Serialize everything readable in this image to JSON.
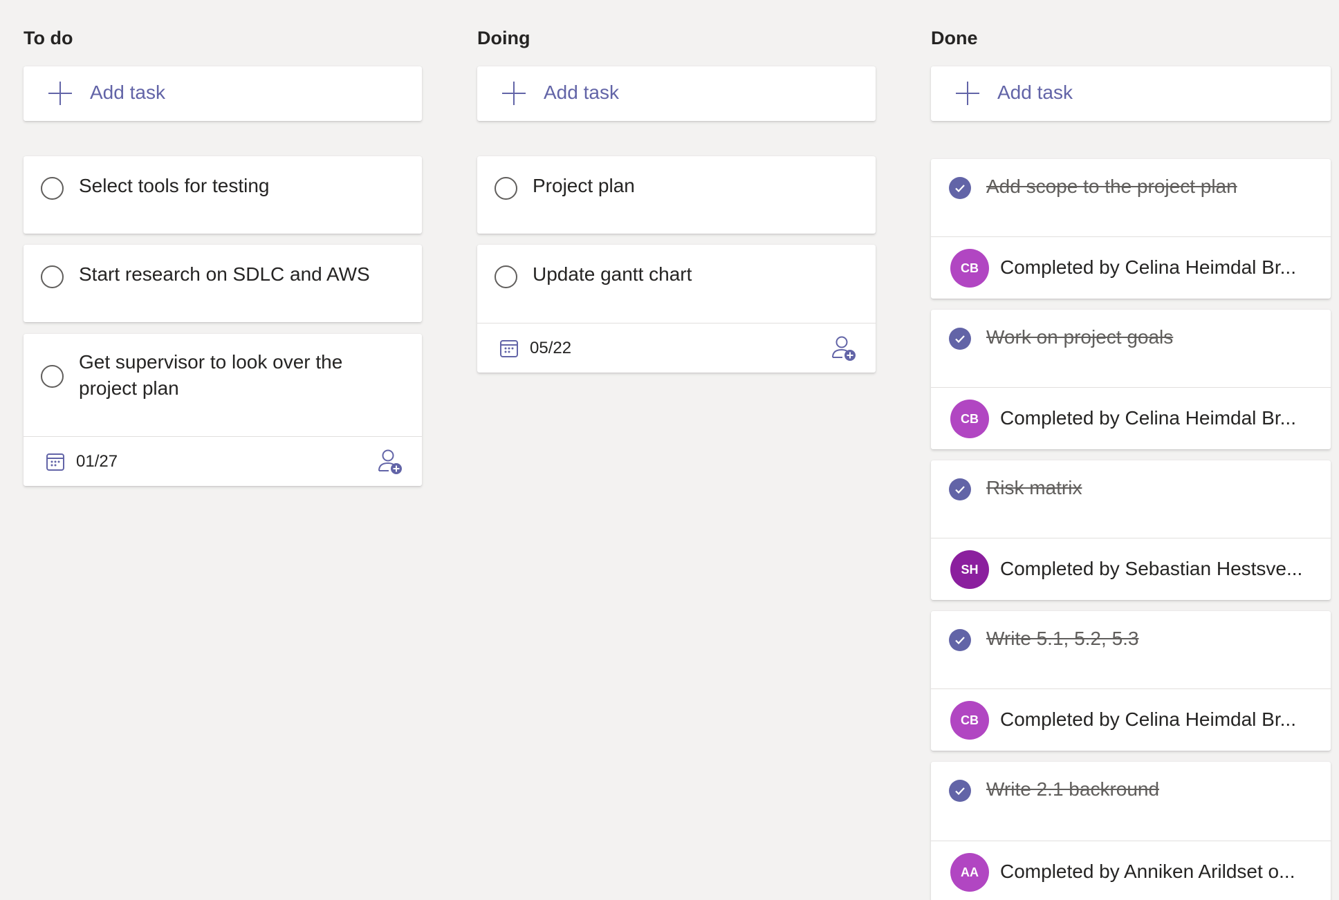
{
  "columns": {
    "todo": {
      "title": "To do",
      "add_task_label": "Add task",
      "cards": [
        {
          "title": "Select tools for testing"
        },
        {
          "title": "Start research on SDLC and AWS"
        },
        {
          "title": "Get supervisor to look over the project plan",
          "due": "01/27"
        }
      ]
    },
    "doing": {
      "title": "Doing",
      "add_task_label": "Add task",
      "cards": [
        {
          "title": "Project plan"
        },
        {
          "title": "Update gantt chart",
          "due": "05/22"
        }
      ]
    },
    "done": {
      "title": "Done",
      "add_task_label": "Add task",
      "cards": [
        {
          "title": "Add scope to the project plan",
          "initials": "CB",
          "completed_by": "Completed by Celina Heimdal Br..."
        },
        {
          "title": "Work on project goals",
          "initials": "CB",
          "completed_by": "Completed by Celina Heimdal Br..."
        },
        {
          "title": "Risk matrix",
          "initials": "SH",
          "completed_by": "Completed by Sebastian Hestsve..."
        },
        {
          "title": "Write 5.1, 5.2, 5.3",
          "initials": "CB",
          "completed_by": "Completed by Celina Heimdal Br..."
        },
        {
          "title": "Write 2.1 backround",
          "initials": "AA",
          "completed_by": "Completed by Anniken Arildset o..."
        }
      ]
    }
  },
  "colors": {
    "accent": "#6264a7",
    "avatar_cb": "#b146c2",
    "avatar_sh": "#8b1f9e",
    "avatar_aa": "#b146c2",
    "background": "#f3f2f1"
  }
}
